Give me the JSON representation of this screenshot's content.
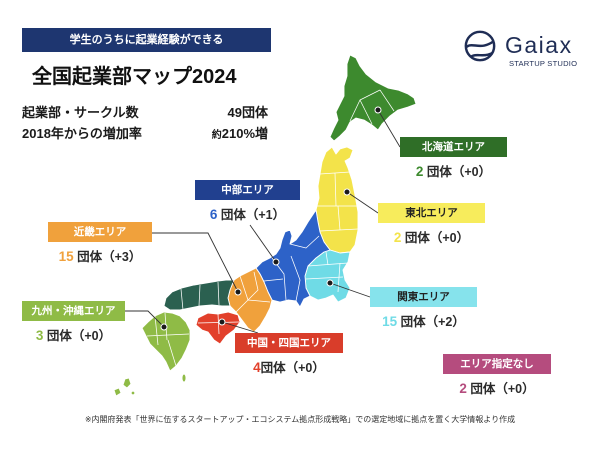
{
  "header": {
    "banner": "学生のうちに起業経験ができる",
    "banner_color": "#1e3670",
    "title": "全国起業部マップ2024",
    "stats": {
      "clubs": {
        "label": "起業部・サークル数",
        "value": "49団体"
      },
      "growth": {
        "label": "2018年からの増加率",
        "value_prefix": "約",
        "value": "210%増"
      }
    }
  },
  "logo": {
    "icon": "gaiax-logo-icon",
    "name": "Gaiax",
    "tagline": "STARTUP STUDIO",
    "color": "#1f2d55"
  },
  "regions": {
    "hokkaido": {
      "label": "北海道エリア",
      "count": "2",
      "unit_and_change": " 団体（+0）",
      "color": "#3d8a2e",
      "box_color": "#2f6e27",
      "label_text_color": "#ffffff"
    },
    "chubu": {
      "label": "中部エリア",
      "count": "6",
      "unit_and_change": " 団体（+1）",
      "color": "#2d62c8",
      "box_color": "#21408f",
      "label_text_color": "#ffffff"
    },
    "tohoku": {
      "label": "東北エリア",
      "count": "2",
      "unit_and_change": " 団体（+0）",
      "color": "#f3e34a",
      "box_color": "#f7ec5c",
      "label_text_color": "#222222"
    },
    "kinki": {
      "label": "近畿エリア",
      "count": "15",
      "unit_and_change": " 団体（+3）",
      "color": "#f0a13c",
      "box_color": "#f0a13c",
      "label_text_color": "#ffffff"
    },
    "kanto": {
      "label": "関東エリア",
      "count": "15",
      "unit_and_change": " 団体（+2）",
      "color": "#6fdbe6",
      "box_color": "#86e3ec",
      "label_text_color": "#222222"
    },
    "kyushu_okinawa": {
      "label": "九州・沖縄エリア",
      "count": "3",
      "unit_and_change": " 団体（+0）",
      "color": "#8fbb46",
      "box_color": "#8fbb46",
      "label_text_color": "#ffffff"
    },
    "chugoku_shikoku": {
      "label": "中国・四国エリア",
      "count": "4",
      "unit_and_change": "団体（+0）",
      "color": "#e2402b",
      "box_color": "#d93d2a",
      "label_text_color": "#ffffff"
    },
    "unspecified": {
      "label": "エリア指定なし",
      "count": "2",
      "unit_and_change": " 団体（+0）",
      "color": "#b54c7e",
      "box_color": "#b54c7e",
      "label_text_color": "#ffffff"
    }
  },
  "footnote": "※内閣府発表「世界に伍するスタートアップ・エコシステム拠点形成戦略」での選定地域に拠点を置く大学情報より作成"
}
